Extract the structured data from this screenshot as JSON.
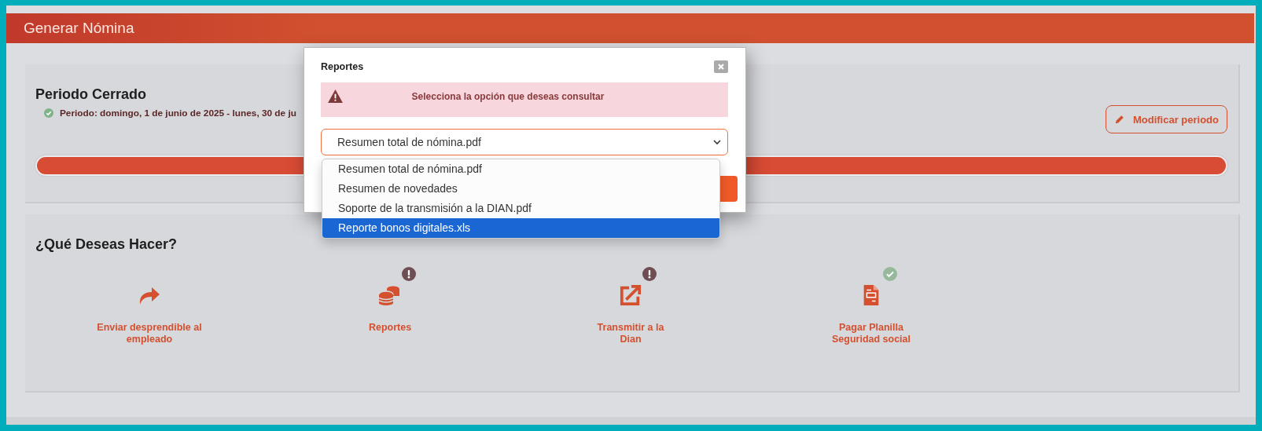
{
  "header": {
    "title": "Generar Nómina"
  },
  "period": {
    "title": "Periodo Cerrado",
    "text": "Periodo: domingo, 1 de junio de 2025 - lunes, 30 de ju",
    "modify_button": "Modificar periodo",
    "level": 1
  },
  "actions": {
    "title": "¿Qué Deseas Hacer?",
    "items": [
      {
        "label": "Enviar desprendible al empleado",
        "warning": false,
        "completed": false
      },
      {
        "label": "Reportes",
        "warning": true,
        "completed": false
      },
      {
        "label": "Transmitir a la Dian",
        "warning": true,
        "completed": false
      },
      {
        "label": "Pagar Planilla Seguridad social",
        "warning": false,
        "completed": true
      }
    ]
  },
  "modal": {
    "title": "Reportes",
    "alert": "Selecciona la opción que deseas consultar",
    "select_value": "Resumen total de nómina.pdf",
    "options": [
      {
        "label": "Resumen total de nómina.pdf",
        "highlighted": false
      },
      {
        "label": "Resumen de novedades",
        "highlighted": false
      },
      {
        "label": "Soporte de la transmisión a la DIAN.pdf",
        "highlighted": false
      },
      {
        "label": "Reporte bonos digitales.xls",
        "highlighted": true
      }
    ]
  }
}
